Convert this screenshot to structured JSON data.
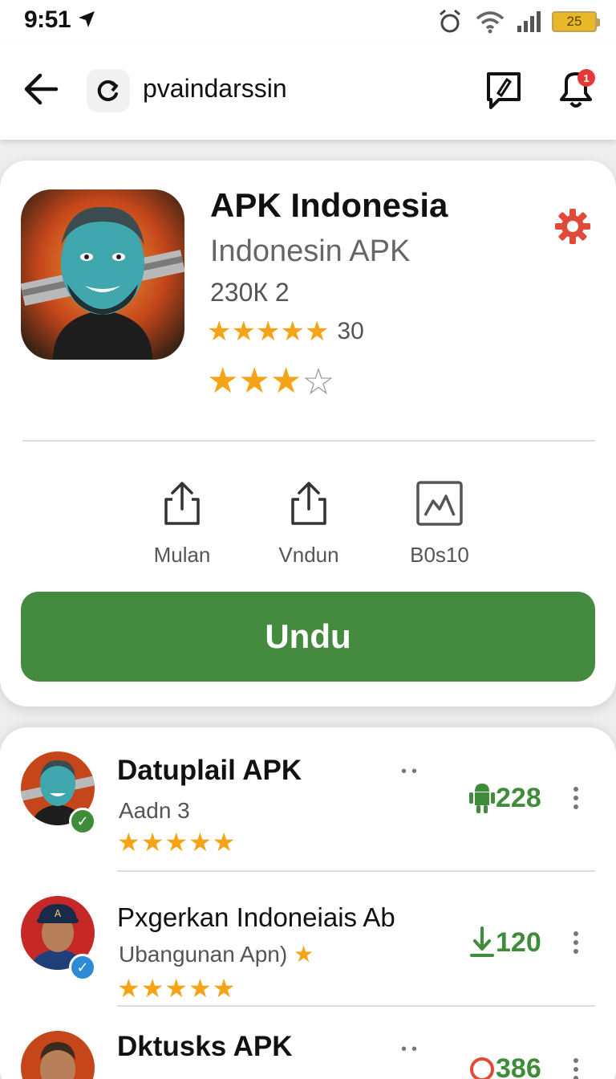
{
  "status_bar": {
    "time": "9:51",
    "battery": "25"
  },
  "top_bar": {
    "url_text": "pvaindarssin",
    "notification_count": "1"
  },
  "app": {
    "title": "APK Indonesia",
    "subtitle": "Indonesin APK",
    "size": "230К 2",
    "rating_count": "30",
    "rating_stars": 3,
    "actions": [
      {
        "label": "Mulan",
        "icon": "share-icon"
      },
      {
        "label": "Vndun",
        "icon": "share-icon"
      },
      {
        "label": "B0s10",
        "icon": "image-icon"
      }
    ],
    "download_label": "Undu"
  },
  "list": {
    "items": [
      {
        "title": "Datuplail APK",
        "subtitle": "Aadn 3",
        "count": "228",
        "stars": "★★★★★"
      },
      {
        "title": "Pxgerkan Indoneiais Ab",
        "subtitle": "Ubangunan Apn)",
        "count": "120",
        "stars": "★★★★★"
      },
      {
        "title": "Dktusks APK",
        "subtitle": "",
        "count": "386",
        "stars": ""
      }
    ]
  },
  "colors": {
    "accent_green": "#458b3f",
    "star": "#f4a416",
    "badge_red": "#e53935"
  }
}
